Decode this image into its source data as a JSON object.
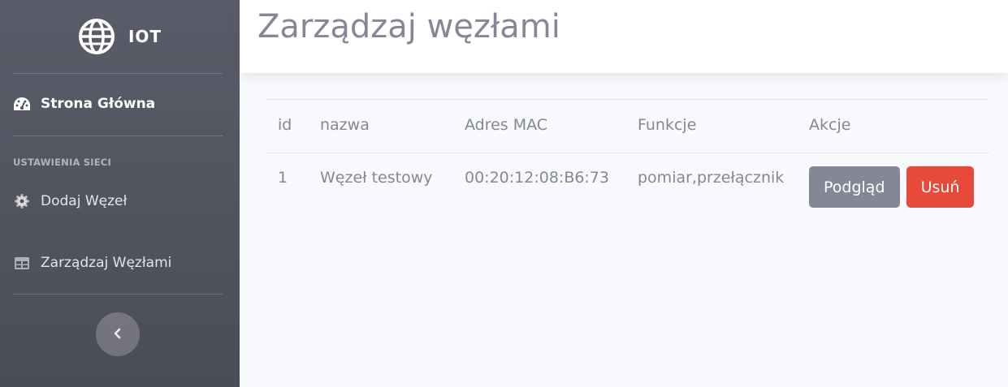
{
  "sidebar": {
    "brand": {
      "icon": "globe-icon",
      "text": "IOT"
    },
    "items": [
      {
        "label": "Strona Główna",
        "icon": "tachometer-icon",
        "active": true
      },
      {
        "label": "Dodaj Węzeł",
        "icon": "gear-icon",
        "active": false
      },
      {
        "label": "Zarządzaj Węzłami",
        "icon": "table-icon",
        "active": false
      }
    ],
    "heading": "USTAWIENIA SIECI",
    "toggle_icon": "chevron-left-icon"
  },
  "header": {
    "title": "Zarządzaj węzłami"
  },
  "table": {
    "columns": [
      "id",
      "nazwa",
      "Adres MAC",
      "Funkcje",
      "Akcje"
    ],
    "rows": [
      {
        "id": "1",
        "nazwa": "Węzeł testowy",
        "mac": "00:20:12:08:B6:73",
        "funkcje": "pomiar,przełącznik",
        "actions": {
          "view": "Podgląd",
          "delete": "Usuń"
        }
      }
    ]
  },
  "colors": {
    "sidebar_top": "#5a5c69",
    "sidebar_bottom": "#4a4c57",
    "text_muted": "#858796",
    "danger": "#e74a3b",
    "secondary": "#858796"
  }
}
